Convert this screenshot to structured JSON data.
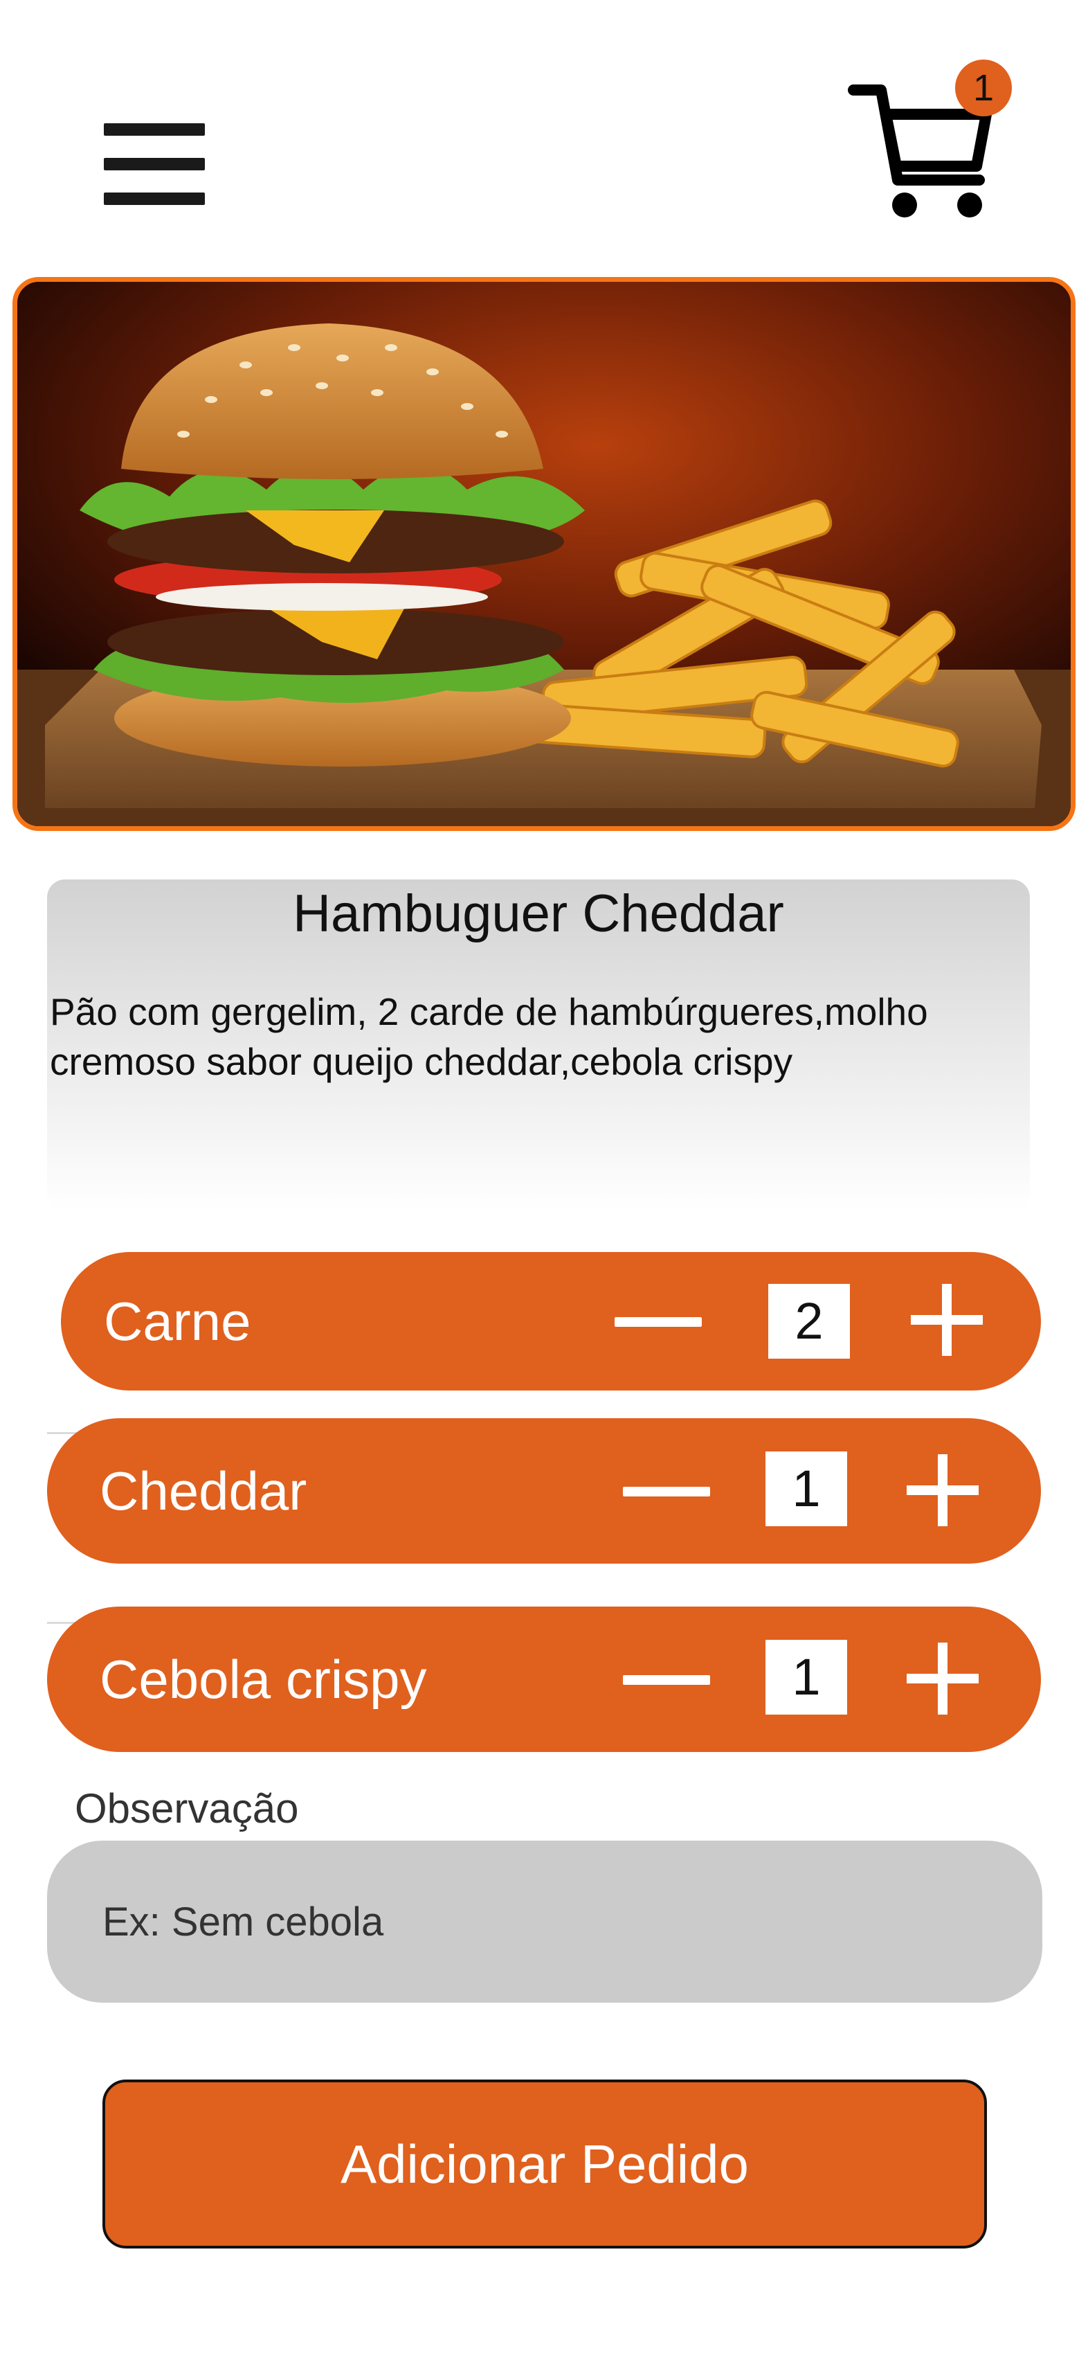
{
  "header": {
    "menu_icon": "hamburger-menu-icon",
    "cart_icon": "shopping-cart-icon",
    "cart_count": "1"
  },
  "product": {
    "image_icon": "burger-and-fries-photo",
    "title": "Hambuguer Cheddar",
    "description": "Pão com gergelim, 2 carde de hambúrgueres,molho cremoso sabor queijo cheddar,cebola crispy"
  },
  "options": [
    {
      "label": "Carne",
      "quantity": "2"
    },
    {
      "label": "Cheddar",
      "quantity": "1"
    },
    {
      "label": "Cebola crispy",
      "quantity": "1"
    }
  ],
  "observation": {
    "label": "Observação",
    "placeholder": "Ex: Sem cebola",
    "value": ""
  },
  "submit_label": "Adicionar Pedido",
  "colors": {
    "accent": "#e0601e",
    "hero_border": "#f57516",
    "input_bg": "#cbcbcb"
  }
}
